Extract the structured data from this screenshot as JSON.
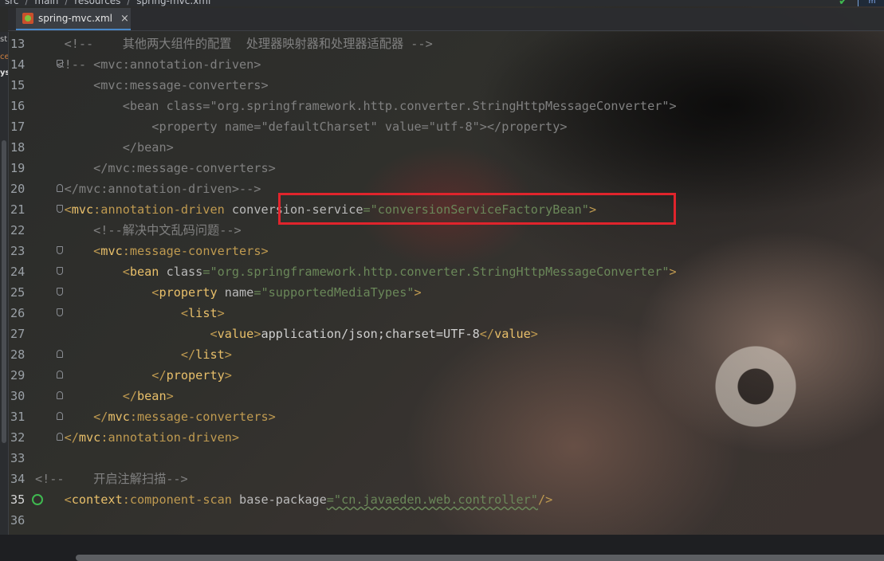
{
  "breadcrumb": [
    "src",
    "main",
    "resources",
    "spring-mvc.xml"
  ],
  "tab": {
    "label": "spring-mvc.xml",
    "close": "×"
  },
  "side_fragment": [
    "st",
    "ce",
    "ys"
  ],
  "lines": [
    {
      "n": "13",
      "segments": [
        [
          "cm",
          "    <!--    其他两大组件的配置  处理器映射器和处理器适配器 -->"
        ]
      ]
    },
    {
      "n": "14",
      "segments": [
        [
          "cm",
          "   <!-- <mvc:annotation-driven>"
        ]
      ]
    },
    {
      "n": "15",
      "segments": [
        [
          "cm",
          "        <mvc:message-converters>"
        ]
      ]
    },
    {
      "n": "16",
      "segments": [
        [
          "cm",
          "            <bean class=\"org.springframework.http.converter.StringHttpMessageConverter\">"
        ]
      ]
    },
    {
      "n": "17",
      "segments": [
        [
          "cm",
          "                <property name=\"defaultCharset\" value=\"utf-8\"></property>"
        ]
      ]
    },
    {
      "n": "18",
      "segments": [
        [
          "cm",
          "            </bean>"
        ]
      ]
    },
    {
      "n": "19",
      "segments": [
        [
          "cm",
          "        </mvc:message-converters>"
        ]
      ]
    },
    {
      "n": "20",
      "segments": [
        [
          "cm",
          "    </mvc:annotation-driven>-->"
        ]
      ]
    },
    {
      "n": "21",
      "segments": [
        [
          "tag-faded",
          "    <"
        ],
        [
          "tag",
          "mvc"
        ],
        [
          "tag-faded",
          ":annotation-driven "
        ],
        [
          "attr",
          "conversion-service"
        ],
        [
          "val",
          "=\"conversionServiceFactoryBean\""
        ],
        [
          "tag-faded",
          ">"
        ]
      ]
    },
    {
      "n": "22",
      "segments": [
        [
          "cm",
          "        <!--解决中文乱码问题-->"
        ]
      ]
    },
    {
      "n": "23",
      "segments": [
        [
          "tag-faded",
          "        <"
        ],
        [
          "tag",
          "mvc"
        ],
        [
          "tag-faded",
          ":message-converters>"
        ]
      ]
    },
    {
      "n": "24",
      "segments": [
        [
          "tag-faded",
          "            <"
        ],
        [
          "tag",
          "bean "
        ],
        [
          "attr",
          "class"
        ],
        [
          "val",
          "=\"org.springframework.http.converter.StringHttpMessageConverter\""
        ],
        [
          "tag-faded",
          ">"
        ]
      ]
    },
    {
      "n": "25",
      "segments": [
        [
          "tag-faded",
          "                <"
        ],
        [
          "tag",
          "property "
        ],
        [
          "attr",
          "name"
        ],
        [
          "val",
          "=\"supportedMediaTypes\""
        ],
        [
          "tag-faded",
          ">"
        ]
      ]
    },
    {
      "n": "26",
      "segments": [
        [
          "tag-faded",
          "                    <"
        ],
        [
          "tag",
          "list"
        ],
        [
          "tag-faded",
          ">"
        ]
      ]
    },
    {
      "n": "27",
      "segments": [
        [
          "tag-faded",
          "                        <"
        ],
        [
          "tag",
          "value"
        ],
        [
          "tag-faded",
          ">"
        ],
        [
          "text",
          "application/json;charset=UTF-8"
        ],
        [
          "tag-faded",
          "</"
        ],
        [
          "tag",
          "value"
        ],
        [
          "tag-faded",
          ">"
        ]
      ]
    },
    {
      "n": "28",
      "segments": [
        [
          "tag-faded",
          "                    </"
        ],
        [
          "tag",
          "list"
        ],
        [
          "tag-faded",
          ">"
        ]
      ]
    },
    {
      "n": "29",
      "segments": [
        [
          "tag-faded",
          "                </"
        ],
        [
          "tag",
          "property"
        ],
        [
          "tag-faded",
          ">"
        ]
      ]
    },
    {
      "n": "30",
      "segments": [
        [
          "tag-faded",
          "            </"
        ],
        [
          "tag",
          "bean"
        ],
        [
          "tag-faded",
          ">"
        ]
      ]
    },
    {
      "n": "31",
      "segments": [
        [
          "tag-faded",
          "        </"
        ],
        [
          "tag",
          "mvc"
        ],
        [
          "tag-faded",
          ":message-converters>"
        ]
      ]
    },
    {
      "n": "32",
      "segments": [
        [
          "tag-faded",
          "    </"
        ],
        [
          "tag",
          "mvc"
        ],
        [
          "tag-faded",
          ":annotation-driven>"
        ]
      ]
    },
    {
      "n": "33",
      "segments": []
    },
    {
      "n": "34",
      "segments": [
        [
          "cm",
          "<!--    开启注解扫描-->"
        ]
      ]
    },
    {
      "n": "35",
      "segments": [
        [
          "tag-faded",
          "    <"
        ],
        [
          "tag",
          "context"
        ],
        [
          "tag-faded",
          ":component-scan "
        ],
        [
          "attr",
          "base-package"
        ],
        [
          "val",
          "=\"cn.javaeden.web.controller\""
        ],
        [
          "tag-faded",
          "/>"
        ]
      ]
    },
    {
      "n": "36",
      "segments": []
    }
  ],
  "folds": {
    "14": "start",
    "20": "end",
    "21": "start",
    "23": "start",
    "24": "start",
    "25": "start",
    "26": "start",
    "28": "end",
    "29": "end",
    "30": "end",
    "31": "end",
    "32": "end",
    "35": "none"
  },
  "colors": {
    "highlight_box": "#e0242c",
    "tag": "#e8bf6a",
    "attr": "#bababa",
    "value": "#6a8759",
    "comment": "#808080"
  }
}
